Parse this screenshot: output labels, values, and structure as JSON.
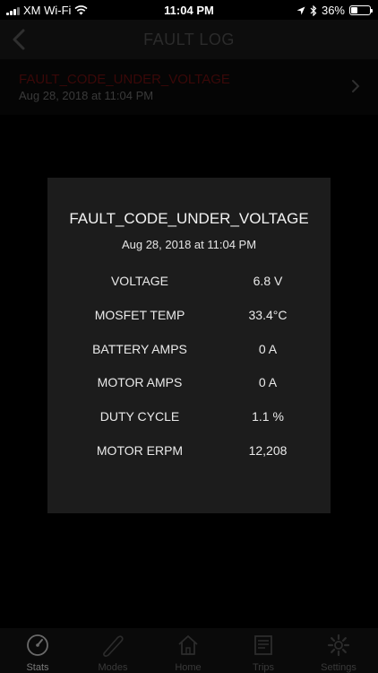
{
  "status_bar": {
    "carrier": "XM Wi-Fi",
    "time": "11:04 PM",
    "battery_percent": "36%",
    "battery_level": 0.36
  },
  "nav": {
    "title": "FAULT LOG",
    "back_icon": "chevron-left-icon"
  },
  "fault_list": [
    {
      "code": "FAULT_CODE_UNDER_VOLTAGE",
      "timestamp": "Aug 28, 2018 at 11:04 PM"
    }
  ],
  "dialog": {
    "title": "FAULT_CODE_UNDER_VOLTAGE",
    "timestamp": "Aug 28, 2018 at 11:04 PM",
    "stats": [
      {
        "label": "VOLTAGE",
        "value": "6.8 V"
      },
      {
        "label": "MOSFET TEMP",
        "value": "33.4°C"
      },
      {
        "label": "BATTERY AMPS",
        "value": "0 A"
      },
      {
        "label": "MOTOR AMPS",
        "value": "0 A"
      },
      {
        "label": "DUTY CYCLE",
        "value": "1.1 %"
      },
      {
        "label": "MOTOR ERPM",
        "value": "12,208"
      }
    ]
  },
  "tabs": [
    {
      "label": "Stats",
      "icon": "speedometer-icon",
      "active": true
    },
    {
      "label": "Modes",
      "icon": "skateboard-icon",
      "active": false
    },
    {
      "label": "Home",
      "icon": "home-icon",
      "active": false
    },
    {
      "label": "Trips",
      "icon": "map-icon",
      "active": false
    },
    {
      "label": "Settings",
      "icon": "gear-icon",
      "active": false
    }
  ],
  "colors": {
    "background": "#000000",
    "dialog_background": "#1c1c1c",
    "fault_code_dimmed": "#3a0808"
  }
}
